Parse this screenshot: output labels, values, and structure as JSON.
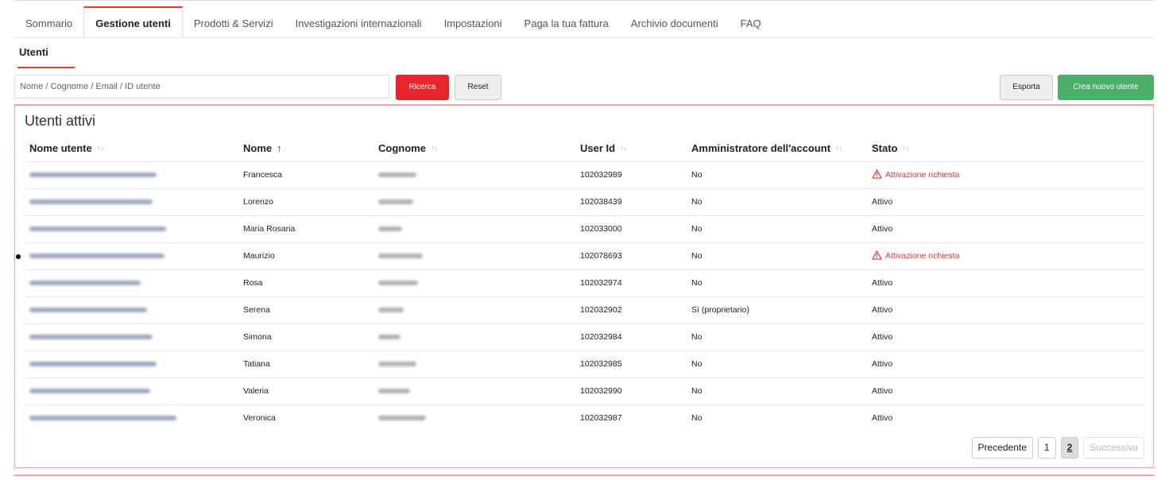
{
  "tabs": [
    {
      "label": "Sommario"
    },
    {
      "label": "Gestione utenti"
    },
    {
      "label": "Prodotti & Servizi"
    },
    {
      "label": "Investigazioni internazionali"
    },
    {
      "label": "Impostazioni"
    },
    {
      "label": "Paga la tua fattura"
    },
    {
      "label": "Archivio documenti"
    },
    {
      "label": "FAQ"
    }
  ],
  "active_tab": "Gestione utenti",
  "subtab": {
    "label": "Utenti"
  },
  "search": {
    "placeholder": "Nome / Cognome / Email / ID utente",
    "value": ""
  },
  "toolbar": {
    "search_label": "Ricerca",
    "reset_label": "Reset",
    "export_label": "Esporta",
    "new_user_label": "Crea nuovo utente"
  },
  "panel": {
    "title": "Utenti attivi"
  },
  "table": {
    "headers": {
      "username": "Nome utente",
      "first_name": "Nome",
      "last_name": "Cognome",
      "user_id": "User Id",
      "admin": "Amministratore dell'account",
      "status": "Stato"
    },
    "rows": [
      {
        "first_name": "Francesca",
        "user_id": "102032989",
        "admin": "No",
        "status": "Attivazione richiesta",
        "warning": true
      },
      {
        "first_name": "Lorenzo",
        "user_id": "102038439",
        "admin": "No",
        "status": "Attivo",
        "warning": false
      },
      {
        "first_name": "Maria Rosaria",
        "user_id": "102033000",
        "admin": "No",
        "status": "Attivo",
        "warning": false
      },
      {
        "first_name": "Maurizio",
        "user_id": "102078693",
        "admin": "No",
        "status": "Attivazione richiesta",
        "warning": true
      },
      {
        "first_name": "Rosa",
        "user_id": "102032974",
        "admin": "No",
        "status": "Attivo",
        "warning": false
      },
      {
        "first_name": "Serena",
        "user_id": "102032902",
        "admin": "Sì (proprietario)",
        "status": "Attivo",
        "warning": false
      },
      {
        "first_name": "Simona",
        "user_id": "102032984",
        "admin": "No",
        "status": "Attivo",
        "warning": false
      },
      {
        "first_name": "Tatiana",
        "user_id": "102032985",
        "admin": "No",
        "status": "Attivo",
        "warning": false
      },
      {
        "first_name": "Valeria",
        "user_id": "102032990",
        "admin": "No",
        "status": "Attivo",
        "warning": false
      },
      {
        "first_name": "Veronica",
        "user_id": "102032987",
        "admin": "No",
        "status": "Attivo",
        "warning": false
      }
    ]
  },
  "pagination": {
    "prev_label": "Precedente",
    "pages": [
      "1",
      "2"
    ],
    "current_page": "2",
    "next_label": "Successiva"
  },
  "colors": {
    "accent": "#e8252a",
    "success": "#4caf6a",
    "panel_border": "#f1a5a5",
    "warning": "#e53935"
  },
  "icons": {
    "sort": "sort-icon",
    "sort_active": "arrow-up-icon",
    "warning": "warning-triangle-icon"
  }
}
